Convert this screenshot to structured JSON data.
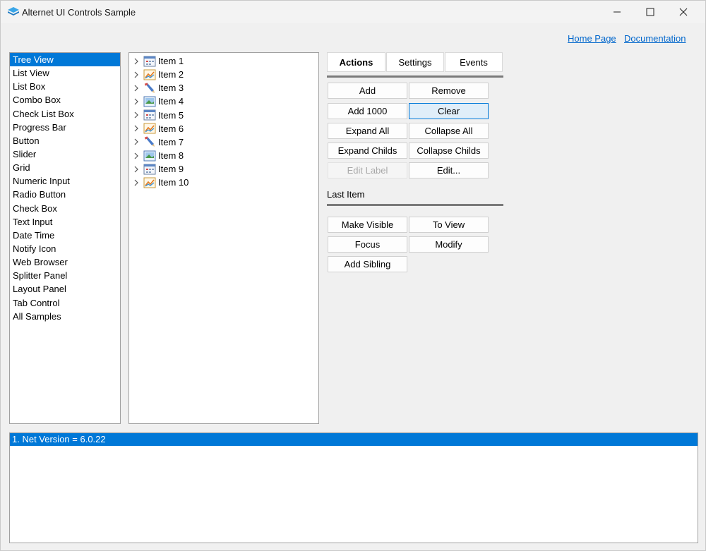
{
  "window": {
    "title": "Alternet UI Controls Sample"
  },
  "header_links": {
    "home": "Home Page",
    "docs": "Documentation"
  },
  "samples": {
    "items": [
      "Tree View",
      "List View",
      "List Box",
      "Combo Box",
      "Check List Box",
      "Progress Bar",
      "Button",
      "Slider",
      "Grid",
      "Numeric Input",
      "Radio Button",
      "Check Box",
      "Text Input",
      "Date Time",
      "Notify Icon",
      "Web Browser",
      "Splitter Panel",
      "Layout Panel",
      "Tab Control",
      "All Samples"
    ],
    "selected_index": 0
  },
  "tree": {
    "items": [
      {
        "label": "Item 1",
        "icon": "calendar-icon"
      },
      {
        "label": "Item 2",
        "icon": "chart-icon"
      },
      {
        "label": "Item 3",
        "icon": "pencil-icon"
      },
      {
        "label": "Item 4",
        "icon": "calendar-icon"
      },
      {
        "label": "Item 5",
        "icon": "calendar-icon"
      },
      {
        "label": "Item 6",
        "icon": "chart-icon"
      },
      {
        "label": "Item 7",
        "icon": "pencil-icon"
      },
      {
        "label": "Item 8",
        "icon": "picture-icon"
      },
      {
        "label": "Item 9",
        "icon": "calendar-icon"
      },
      {
        "label": "Item 10",
        "icon": "chart-icon"
      }
    ]
  },
  "tabs": {
    "actions": "Actions",
    "settings": "Settings",
    "events": "Events",
    "active": "Actions"
  },
  "actions": {
    "add": "Add",
    "remove": "Remove",
    "add1000": "Add 1000",
    "clear": "Clear",
    "expand_all": "Expand All",
    "collapse_all": "Collapse All",
    "expand_childs": "Expand Childs",
    "collapse_childs": "Collapse Childs",
    "edit_label": "Edit Label",
    "edit": "Edit..."
  },
  "last_item": {
    "heading": "Last Item",
    "make_visible": "Make Visible",
    "to_view": "To View",
    "focus": "Focus",
    "modify": "Modify",
    "add_sibling": "Add Sibling"
  },
  "log": {
    "lines": [
      "1. Net Version = 6.0.22"
    ]
  },
  "colors": {
    "selection": "#0078d7",
    "link": "#0066cc"
  }
}
